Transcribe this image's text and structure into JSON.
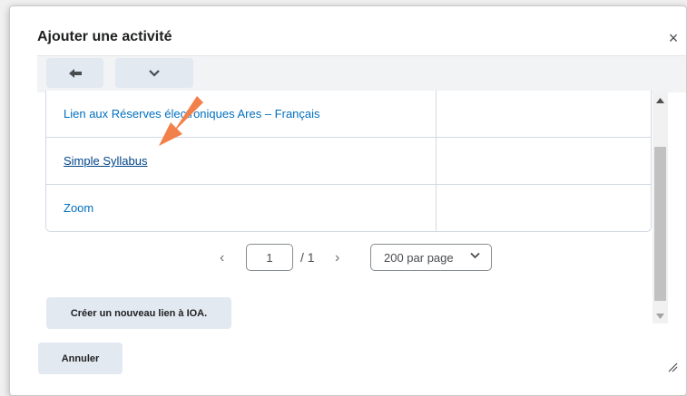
{
  "dialog": {
    "title": "Ajouter une activité",
    "close_icon": "×"
  },
  "toolbar": {
    "back_icon": "arrow-left-icon",
    "more_icon": "chevron-down-icon"
  },
  "table": {
    "rows": [
      {
        "name": "Lien aux Réserves électroniques Ares – Français"
      },
      {
        "name": "Simple Syllabus"
      },
      {
        "name": "Zoom"
      }
    ]
  },
  "pager": {
    "current_page": "1",
    "total": "/ 1",
    "prev_icon": "‹",
    "next_icon": "›",
    "page_size": "200 par page"
  },
  "actions": {
    "create_label": "Créer un nouveau lien à IOA.",
    "cancel_label": "Annuler"
  },
  "colors": {
    "link": "#006fbf",
    "button_bg": "#e3e9f1",
    "annotation_arrow": "#f2804a"
  }
}
